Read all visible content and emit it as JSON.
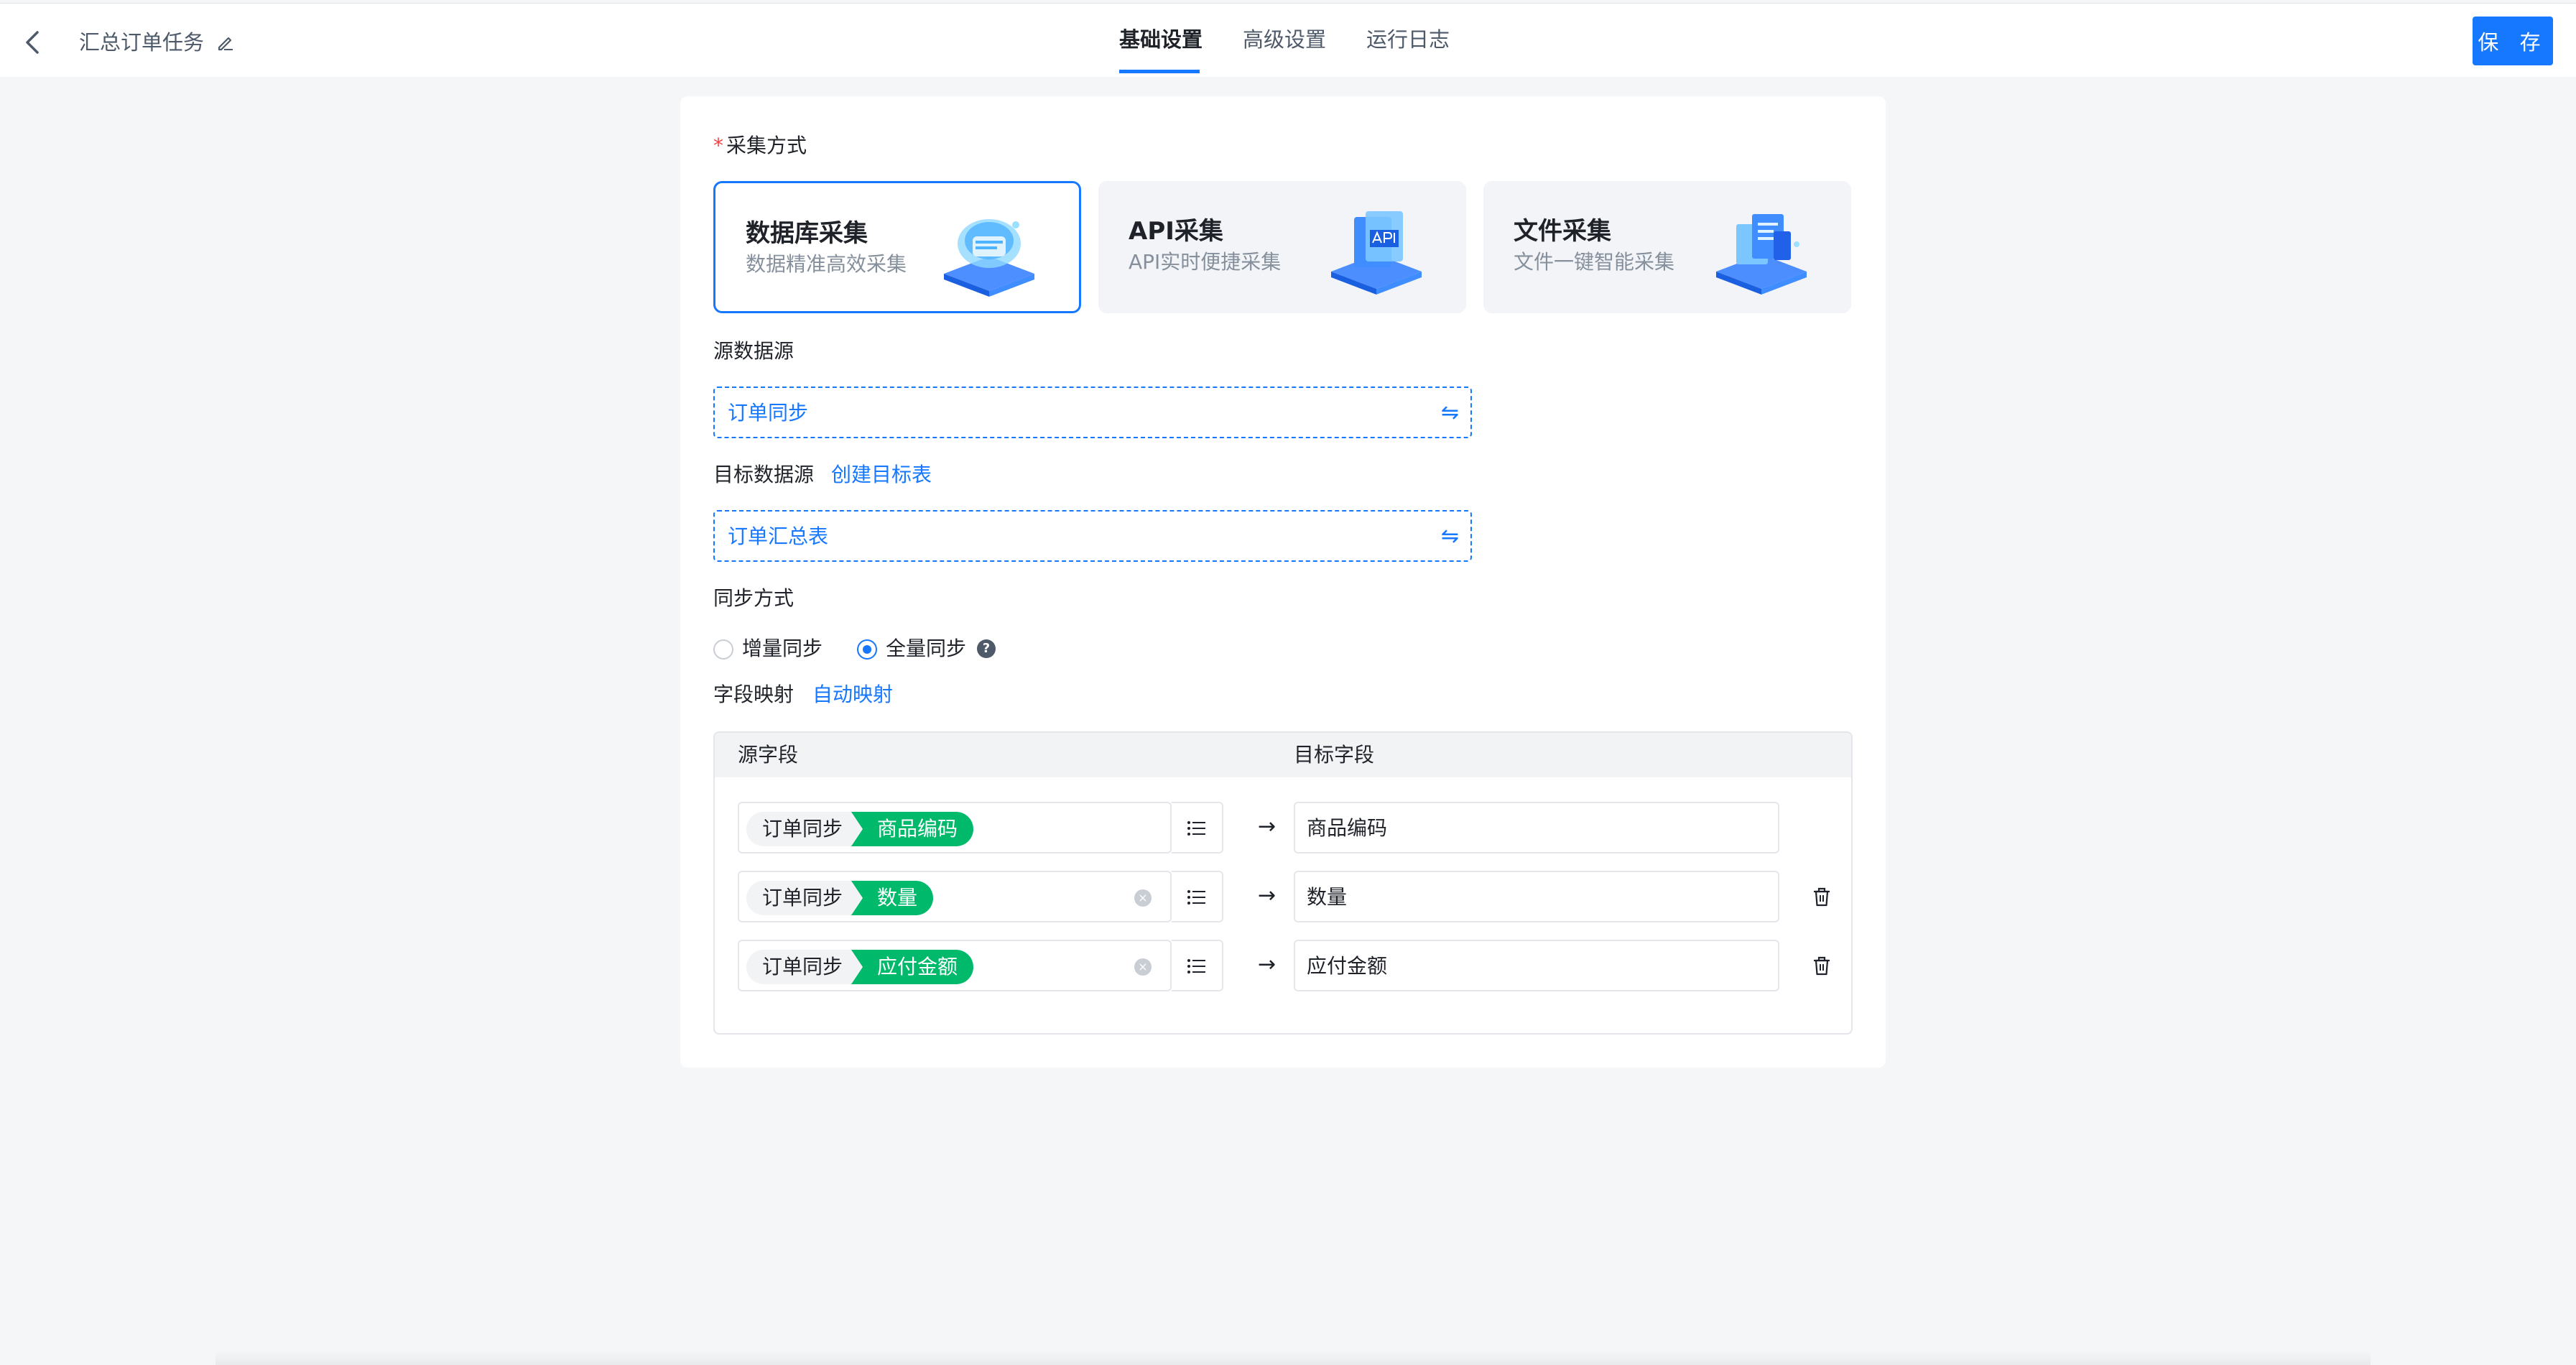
{
  "header": {
    "task_title": "汇总订单任务",
    "tabs": [
      {
        "label": "基础设置",
        "active": true
      },
      {
        "label": "高级设置",
        "active": false
      },
      {
        "label": "运行日志",
        "active": false
      }
    ],
    "save_label": "保 存"
  },
  "form": {
    "collect_method": {
      "label": "采集方式",
      "required": true,
      "options": [
        {
          "title": "数据库采集",
          "subtitle": "数据精准高效采集",
          "selected": true
        },
        {
          "title": "API采集",
          "subtitle": "API实时便捷采集",
          "selected": false
        },
        {
          "title": "文件采集",
          "subtitle": "文件一键智能采集",
          "selected": false
        }
      ]
    },
    "source": {
      "label": "源数据源",
      "value": "订单同步"
    },
    "target": {
      "label": "目标数据源",
      "create_link": "创建目标表",
      "value": "订单汇总表"
    },
    "sync_mode": {
      "label": "同步方式",
      "options": [
        {
          "label": "增量同步",
          "checked": false
        },
        {
          "label": "全量同步",
          "checked": true
        }
      ]
    },
    "field_mapping": {
      "label": "字段映射",
      "auto_link": "自动映射",
      "columns": {
        "source": "源字段",
        "target": "目标字段"
      },
      "rows": [
        {
          "source_table": "订单同步",
          "source_field": "商品编码",
          "target": "商品编码"
        },
        {
          "source_table": "订单同步",
          "source_field": "数量",
          "target": "数量"
        },
        {
          "source_table": "订单同步",
          "source_field": "应付金额",
          "target": "应付金额"
        }
      ]
    }
  },
  "colors": {
    "primary": "#1677ff",
    "field_chip": "#00b96b",
    "required": "#f53f3f"
  }
}
